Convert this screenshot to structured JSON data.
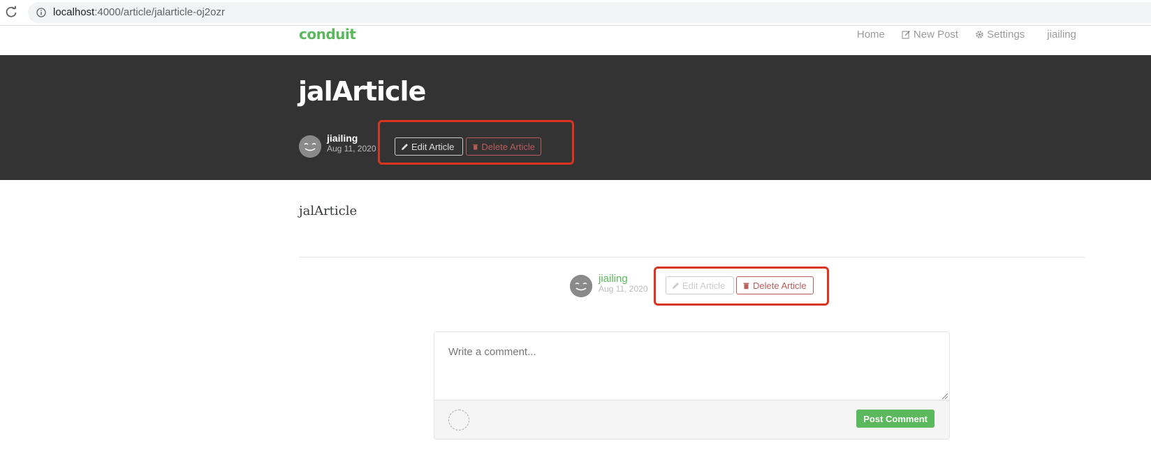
{
  "browser": {
    "url_host": "localhost",
    "url_path": ":4000/article/jalarticle-oj2ozr"
  },
  "navbar": {
    "brand": "conduit",
    "links": [
      {
        "label": "Home",
        "icon": "none"
      },
      {
        "label": "New Post",
        "icon": "edit-icon"
      },
      {
        "label": "Settings",
        "icon": "gear-icon"
      },
      {
        "label": "jiailing",
        "icon": "none"
      }
    ]
  },
  "article": {
    "title": "jalArticle",
    "body": "jalArticle",
    "author": "jiailing",
    "date": "Aug 11, 2020"
  },
  "actions": {
    "edit_label": "Edit Article",
    "delete_label": "Delete Article"
  },
  "comment": {
    "placeholder": "Write a comment...",
    "post_label": "Post Comment"
  },
  "colors": {
    "brand": "#5cb85c",
    "banner": "#333333",
    "danger": "#b85c5c",
    "highlight": "#d9341f"
  }
}
